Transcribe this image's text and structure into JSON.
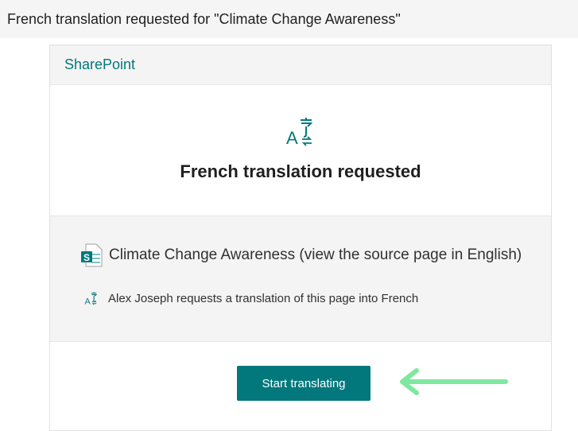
{
  "email": {
    "subject": "French translation requested for \"Climate Change Awareness\""
  },
  "card": {
    "brand": "SharePoint",
    "heading": "French translation requested",
    "page_title": "Climate Change Awareness (view the source page in English)",
    "request_text": "Alex Joseph requests a translation of this page into French",
    "action_label": "Start translating"
  },
  "icons": {
    "hero": "translate-icon",
    "page": "sharepoint-page-icon",
    "request": "translate-icon"
  },
  "colors": {
    "accent": "#03787c",
    "annotation_arrow": "#7ee8a0"
  }
}
